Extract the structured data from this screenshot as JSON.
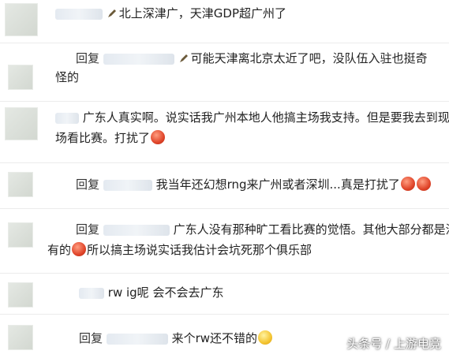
{
  "comments": [
    {
      "text": "北上深津广，天津GDP超广州了"
    },
    {
      "reply_label": "回复",
      "text_line1": "可能天津离北京太近了吧，没队伍入驻也挺奇",
      "text_line2": "怪的"
    },
    {
      "text_line1": "广东人真实啊。说实话我广州本地人他搞主场我支持。但是要我去到现",
      "text_line2": "场看比赛。打扰了"
    },
    {
      "reply_label": "回复",
      "text": "我当年还幻想rng来广州或者深圳...真是打扰了"
    },
    {
      "reply_label": "回复",
      "text_line1": "广东人没有那种旷工看比赛的觉悟。其他大部分都是没",
      "text_line2_a": "有的",
      "text_line2_b": "所以搞主场说实话我估计会坑死那个俱乐部"
    },
    {
      "prefix": "rw ig呢",
      "text": "会不会去广东"
    },
    {
      "reply_label": "回复",
      "text": "来个rw还不错的"
    }
  ],
  "watermark": "头条号 / 上游电竞",
  "icons": [
    "pencil-icon",
    "red-emoji-icon",
    "yellow-smile-emoji-icon"
  ],
  "colors": {
    "text": "#222222",
    "separator": "#ececec",
    "blur": "#dfe6ee"
  }
}
